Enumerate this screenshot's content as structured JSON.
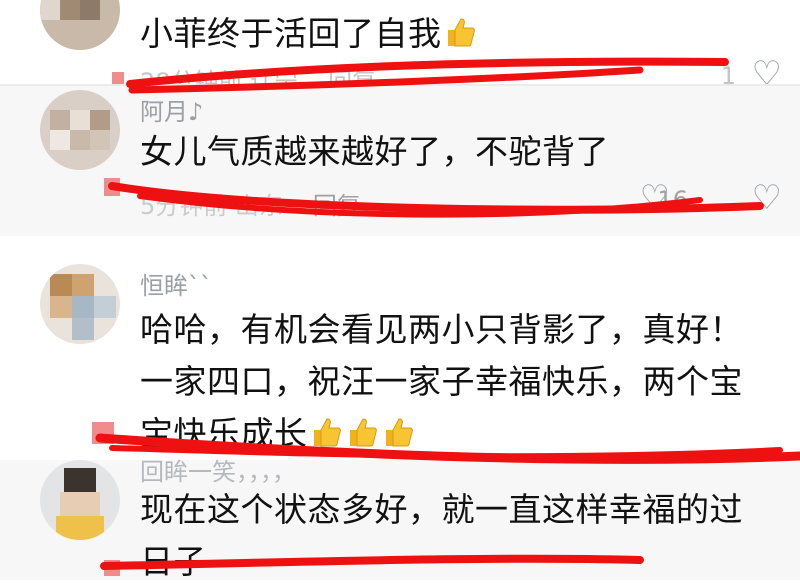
{
  "comments": [
    {
      "name": "",
      "content_lines": [
        "小菲终于活回了自我"
      ],
      "thumbs_count": 1,
      "meta_time": "28分钟前 辽宁",
      "reply_label": "回复",
      "like_count": "1"
    },
    {
      "name": "阿月♪",
      "content_lines": [
        "女儿气质越来越好了，不驼背了"
      ],
      "thumbs_count": 0,
      "meta_time": "5分钟前 山东",
      "reply_label": "回复",
      "like_count": "16"
    },
    {
      "name": "恒眸``",
      "content_lines": [
        "哈哈，有机会看见两小只背影了，真好！",
        "一家四口，祝汪一家子幸福快乐，两个宝",
        "宝快乐成长"
      ],
      "thumbs_count": 3,
      "meta_time": "",
      "reply_label": "",
      "like_count": ""
    },
    {
      "name": "回眸一笑，，，，",
      "content_lines": [
        "现在这个状态多好，就一直这样幸福的过",
        "日子"
      ],
      "thumbs_count": 0,
      "meta_time": "",
      "reply_label": "",
      "like_count": ""
    }
  ],
  "icons": {
    "like": "heart-outline-icon",
    "thumbs": "thumbs-up-emoji-icon"
  },
  "colors": {
    "background": "#ffffff",
    "text": "#111111",
    "muted": "#9aa0a6",
    "highlight_stroke": "#ee1111"
  }
}
